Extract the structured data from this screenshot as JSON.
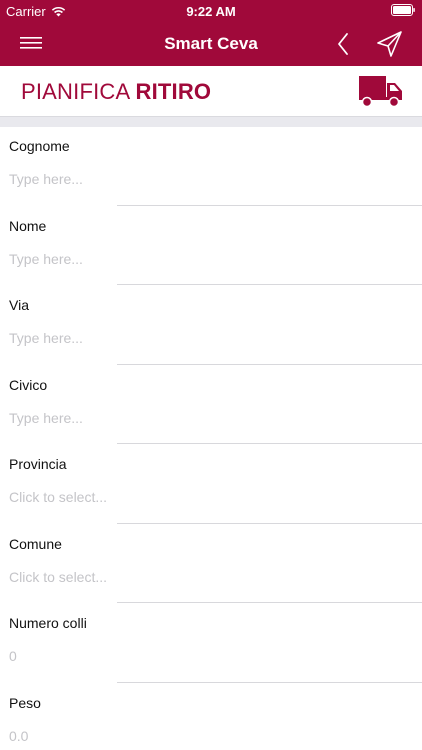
{
  "status_bar": {
    "carrier": "Carrier",
    "time": "9:22 AM"
  },
  "navbar": {
    "title": "Smart Ceva",
    "menu_icon": "hamburger-menu-icon",
    "back_icon": "chevron-left-icon",
    "send_icon": "paper-plane-icon"
  },
  "header": {
    "title_light": "PIANIFICA",
    "title_bold": "RITIRO",
    "truck_icon": "truck-icon"
  },
  "colors": {
    "brand": "#a0093a",
    "placeholder": "#c4c4c8",
    "separator": "#e9e9ee"
  },
  "form": {
    "fields": [
      {
        "label": "Cognome",
        "placeholder": "Type here..."
      },
      {
        "label": "Nome",
        "placeholder": "Type here..."
      },
      {
        "label": "Via",
        "placeholder": "Type here..."
      },
      {
        "label": "Civico",
        "placeholder": "Type here..."
      },
      {
        "label": "Provincia",
        "placeholder": "Click to select..."
      },
      {
        "label": "Comune",
        "placeholder": "Click to select..."
      },
      {
        "label": "Numero colli",
        "placeholder": "0"
      },
      {
        "label": "Peso",
        "placeholder": "0.0"
      }
    ]
  }
}
